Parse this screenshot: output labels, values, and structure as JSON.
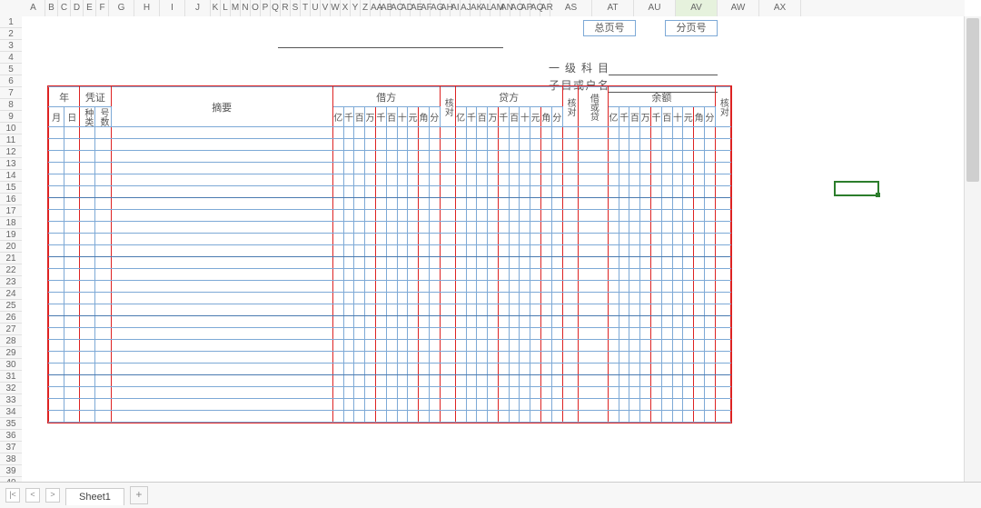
{
  "spreadsheet": {
    "columns": [
      "A",
      "B",
      "C",
      "D",
      "E",
      "F",
      "G",
      "H",
      "I",
      "J",
      "K",
      "L",
      "M",
      "N",
      "O",
      "P",
      "Q",
      "R",
      "S",
      "T",
      "U",
      "V",
      "W",
      "X",
      "Y",
      "Z",
      "AA",
      "AB",
      "AC",
      "AD",
      "AE",
      "AF",
      "AG",
      "AH",
      "AI",
      "AJ",
      "AK",
      "AL",
      "AM",
      "AN",
      "AO",
      "AP",
      "AQ",
      "AR",
      "AS",
      "AT",
      "AU",
      "AV",
      "AW",
      "AX"
    ],
    "selected_column": "AV",
    "visible_rows": 40,
    "selected_cell": {
      "col_index": 47,
      "row_index": 14
    }
  },
  "page_labels": {
    "total": "总页号",
    "sub": "分页号"
  },
  "subject_labels": {
    "primary": "一级科目",
    "detail": "子目或户名"
  },
  "ledger": {
    "headers": {
      "year": "年",
      "voucher": "凭证",
      "summary": "摘要",
      "debit": "借方",
      "check": "核对",
      "credit": "贷方",
      "dc_flag": "借或贷",
      "balance": "余额"
    },
    "subheaders": {
      "month": "月",
      "day": "日",
      "kind": "种类",
      "number": "号数"
    },
    "digit_labels": [
      "亿",
      "千",
      "百",
      "万",
      "千",
      "百",
      "十",
      "元",
      "角",
      "分"
    ]
  },
  "sheet_tab": "Sheet1",
  "add_tab": "+",
  "nav": {
    "first": "|<",
    "prev": "<",
    "next": ">"
  }
}
